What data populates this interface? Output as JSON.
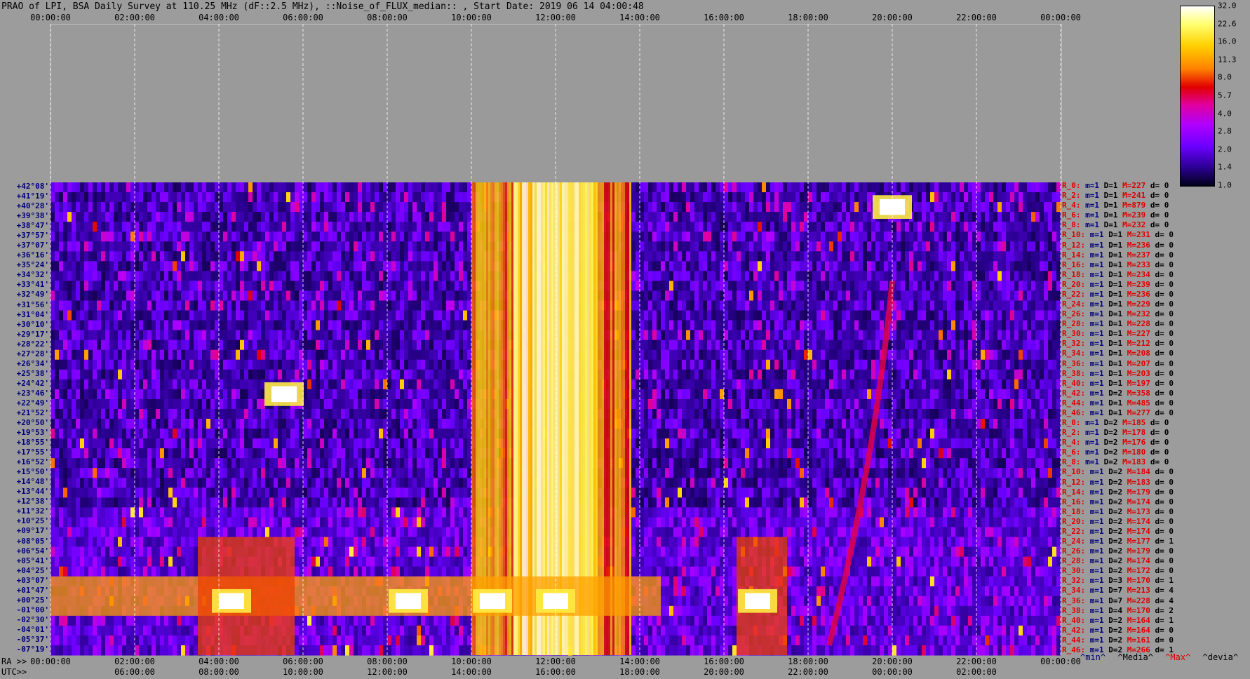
{
  "title": "PRAO of LPI, BSA Daily Survey at 110.25 MHz (dF::2.5 MHz), ::Noise_of_FLUX_median:: , Start Date: 2019 06 14 04:00:48",
  "colors": {
    "background": "#9c9c9c",
    "label_blue": "#00007a",
    "label_red": "#e00000"
  },
  "chart_data": {
    "type": "heatmap",
    "title": "PRAO of LPI, BSA Daily Survey at 110.25 MHz (dF::2.5 MHz), ::Noise_of_FLUX_median:: , Start Date: 2019 06 14 04:00:48",
    "colormap": "fire (black-blue-purple-red-orange-yellow-white)",
    "colorbar_ticks": [
      "32.0",
      "22.6",
      "16.0",
      "11.3",
      "8.0",
      "5.7",
      "4.0",
      "2.8",
      "2.0",
      "1.4",
      "1.0"
    ],
    "colorbar_range": [
      1.0,
      32.0
    ],
    "colorbar_scale": "log",
    "x_top_ticks": [
      "00:00:00",
      "02:00:00",
      "04:00:00",
      "06:00:00",
      "08:00:00",
      "10:00:00",
      "12:00:00",
      "14:00:00",
      "16:00:00",
      "18:00:00",
      "20:00:00",
      "22:00:00",
      "00:00:00"
    ],
    "ra_axis_label": "RA >>",
    "ra_ticks": [
      "00:00:00",
      "02:00:00",
      "04:00:00",
      "06:00:00",
      "08:00:00",
      "10:00:00",
      "12:00:00",
      "14:00:00",
      "16:00:00",
      "18:00:00",
      "20:00:00",
      "22:00:00",
      "00:00:00"
    ],
    "utc_axis_label": "UTC>>",
    "utc_ticks": [
      "06:00:00",
      "08:00:00",
      "10:00:00",
      "12:00:00",
      "14:00:00",
      "16:00:00",
      "18:00:00",
      "20:00:00",
      "22:00:00",
      "00:00:00",
      "02:00:00"
    ],
    "declinations": [
      "+42°08'",
      "+41°19'",
      "+40°28'",
      "+39°38'",
      "+38°47'",
      "+37°57'",
      "+37°07'",
      "+36°16'",
      "+35°24'",
      "+34°32'",
      "+33°41'",
      "+32°49'",
      "+31°56'",
      "+31°04'",
      "+30°10'",
      "+29°17'",
      "+28°22'",
      "+27°28'",
      "+26°34'",
      "+25°38'",
      "+24°42'",
      "+23°46'",
      "+22°49'",
      "+21°52'",
      "+20°50'",
      "+19°53'",
      "+18°55'",
      "+17°55'",
      "+16°52'",
      "+15°50'",
      "+14°48'",
      "+13°44'",
      "+12°38'",
      "+11°32'",
      "+10°25'",
      "+09°17'",
      "+08°05'",
      "+06°54'",
      "+05°41'",
      "+04°25'",
      "+03°07'",
      "+01°47'",
      "+00°25'",
      "-01°00'",
      "-02°30'",
      "-04°01'",
      "-05°37'",
      "-07°19'"
    ],
    "row_stats": [
      {
        "r": "R_0:",
        "m": "m=1",
        "D": "D=1",
        "M": "M=227",
        "d": "d= 0"
      },
      {
        "r": "R_2:",
        "m": "m=1",
        "D": "D=1",
        "M": "M=241",
        "d": "d= 0"
      },
      {
        "r": "R_4:",
        "m": "m=1",
        "D": "D=1",
        "M": "M=879",
        "d": "d= 0"
      },
      {
        "r": "R_6:",
        "m": "m=1",
        "D": "D=1",
        "M": "M=239",
        "d": "d= 0"
      },
      {
        "r": "R_8:",
        "m": "m=1",
        "D": "D=1",
        "M": "M=232",
        "d": "d= 0"
      },
      {
        "r": "R_10:",
        "m": "m=1",
        "D": "D=1",
        "M": "M=231",
        "d": "d= 0"
      },
      {
        "r": "R_12:",
        "m": "m=1",
        "D": "D=1",
        "M": "M=236",
        "d": "d= 0"
      },
      {
        "r": "R_14:",
        "m": "m=1",
        "D": "D=1",
        "M": "M=237",
        "d": "d= 0"
      },
      {
        "r": "R_16:",
        "m": "m=1",
        "D": "D=1",
        "M": "M=233",
        "d": "d= 0"
      },
      {
        "r": "R_18:",
        "m": "m=1",
        "D": "D=1",
        "M": "M=234",
        "d": "d= 0"
      },
      {
        "r": "R_20:",
        "m": "m=1",
        "D": "D=1",
        "M": "M=239",
        "d": "d= 0"
      },
      {
        "r": "R_22:",
        "m": "m=1",
        "D": "D=1",
        "M": "M=236",
        "d": "d= 0"
      },
      {
        "r": "R_24:",
        "m": "m=1",
        "D": "D=1",
        "M": "M=229",
        "d": "d= 0"
      },
      {
        "r": "R_26:",
        "m": "m=1",
        "D": "D=1",
        "M": "M=232",
        "d": "d= 0"
      },
      {
        "r": "R_28:",
        "m": "m=1",
        "D": "D=1",
        "M": "M=228",
        "d": "d= 0"
      },
      {
        "r": "R_30:",
        "m": "m=1",
        "D": "D=1",
        "M": "M=227",
        "d": "d= 0"
      },
      {
        "r": "R_32:",
        "m": "m=1",
        "D": "D=1",
        "M": "M=212",
        "d": "d= 0"
      },
      {
        "r": "R_34:",
        "m": "m=1",
        "D": "D=1",
        "M": "M=208",
        "d": "d= 0"
      },
      {
        "r": "R_36:",
        "m": "m=1",
        "D": "D=1",
        "M": "M=207",
        "d": "d= 0"
      },
      {
        "r": "R_38:",
        "m": "m=1",
        "D": "D=1",
        "M": "M=203",
        "d": "d= 0"
      },
      {
        "r": "R_40:",
        "m": "m=1",
        "D": "D=1",
        "M": "M=197",
        "d": "d= 0"
      },
      {
        "r": "R_42:",
        "m": "m=1",
        "D": "D=2",
        "M": "M=358",
        "d": "d= 0"
      },
      {
        "r": "R_44:",
        "m": "m=1",
        "D": "D=1",
        "M": "M=485",
        "d": "d= 0"
      },
      {
        "r": "R_46:",
        "m": "m=1",
        "D": "D=1",
        "M": "M=277",
        "d": "d= 0"
      },
      {
        "r": "R_0:",
        "m": "m=1",
        "D": "D=2",
        "M": "M=185",
        "d": "d= 0"
      },
      {
        "r": "R_2:",
        "m": "m=1",
        "D": "D=2",
        "M": "M=178",
        "d": "d= 0"
      },
      {
        "r": "R_4:",
        "m": "m=1",
        "D": "D=2",
        "M": "M=176",
        "d": "d= 0"
      },
      {
        "r": "R_6:",
        "m": "m=1",
        "D": "D=2",
        "M": "M=180",
        "d": "d= 0"
      },
      {
        "r": "R_8:",
        "m": "m=1",
        "D": "D=2",
        "M": "M=183",
        "d": "d= 0"
      },
      {
        "r": "R_10:",
        "m": "m=1",
        "D": "D=2",
        "M": "M=184",
        "d": "d= 0"
      },
      {
        "r": "R_12:",
        "m": "m=1",
        "D": "D=2",
        "M": "M=183",
        "d": "d= 0"
      },
      {
        "r": "R_14:",
        "m": "m=1",
        "D": "D=2",
        "M": "M=179",
        "d": "d= 0"
      },
      {
        "r": "R_16:",
        "m": "m=1",
        "D": "D=2",
        "M": "M=174",
        "d": "d= 0"
      },
      {
        "r": "R_18:",
        "m": "m=1",
        "D": "D=2",
        "M": "M=173",
        "d": "d= 0"
      },
      {
        "r": "R_20:",
        "m": "m=1",
        "D": "D=2",
        "M": "M=174",
        "d": "d= 0"
      },
      {
        "r": "R_22:",
        "m": "m=1",
        "D": "D=2",
        "M": "M=174",
        "d": "d= 0"
      },
      {
        "r": "R_24:",
        "m": "m=1",
        "D": "D=2",
        "M": "M=177",
        "d": "d= 1"
      },
      {
        "r": "R_26:",
        "m": "m=1",
        "D": "D=2",
        "M": "M=179",
        "d": "d= 0"
      },
      {
        "r": "R_28:",
        "m": "m=1",
        "D": "D=2",
        "M": "M=174",
        "d": "d= 0"
      },
      {
        "r": "R_30:",
        "m": "m=1",
        "D": "D=2",
        "M": "M=172",
        "d": "d= 0"
      },
      {
        "r": "R_32:",
        "m": "m=1",
        "D": "D=3",
        "M": "M=170",
        "d": "d= 1"
      },
      {
        "r": "R_34:",
        "m": "m=1",
        "D": "D=7",
        "M": "M=213",
        "d": "d= 4"
      },
      {
        "r": "R_36:",
        "m": "m=1",
        "D": "D=7",
        "M": "M=228",
        "d": "d= 4"
      },
      {
        "r": "R_38:",
        "m": "m=1",
        "D": "D=4",
        "M": "M=170",
        "d": "d= 2"
      },
      {
        "r": "R_40:",
        "m": "m=1",
        "D": "D=2",
        "M": "M=164",
        "d": "d= 1"
      },
      {
        "r": "R_42:",
        "m": "m=1",
        "D": "D=2",
        "M": "M=164",
        "d": "d= 0"
      },
      {
        "r": "R_44:",
        "m": "m=1",
        "D": "D=2",
        "M": "M=161",
        "d": "d= 0"
      },
      {
        "r": "R_46:",
        "m": "m=1",
        "D": "D=2",
        "M": "M=266",
        "d": "d= 1"
      }
    ],
    "legend": {
      "min": "^min^",
      "median": "^Media^",
      "max": "^Max^",
      "deviation": "^devia^"
    },
    "features": [
      {
        "type": "vertical_band",
        "ra_start_h": 10.0,
        "ra_end_h": 13.8,
        "intensity": 11.3
      },
      {
        "type": "vertical_band_core",
        "ra_start_h": 11.0,
        "ra_end_h": 13.0,
        "intensity": 22.6
      },
      {
        "type": "horizontal_band",
        "rows": [
          40,
          43
        ],
        "ra_start_h": 0.0,
        "ra_end_h": 14.5,
        "intensity": 11.3
      },
      {
        "type": "horizontal_band",
        "rows": [
          36,
          47
        ],
        "ra_start_h": 3.5,
        "ra_end_h": 5.8,
        "intensity": 8.0
      },
      {
        "type": "horizontal_band",
        "rows": [
          36,
          47
        ],
        "ra_start_h": 16.3,
        "ra_end_h": 17.5,
        "intensity": 8.0
      },
      {
        "type": "source",
        "ra_h": 5.55,
        "row": 21,
        "intensity": 32.0
      },
      {
        "type": "source",
        "ra_h": 20.0,
        "row": 2,
        "intensity": 32.0
      },
      {
        "type": "source",
        "ra_h": 4.3,
        "row": 42,
        "intensity": 32.0
      },
      {
        "type": "source",
        "ra_h": 8.5,
        "row": 42,
        "intensity": 32.0
      },
      {
        "type": "source",
        "ra_h": 10.5,
        "row": 42,
        "intensity": 32.0
      },
      {
        "type": "source",
        "ra_h": 16.8,
        "row": 42,
        "intensity": 32.0
      },
      {
        "type": "source",
        "ra_h": 12.0,
        "row": 42,
        "intensity": 32.0
      },
      {
        "type": "diagonal_arc",
        "ra_start_h": 18.5,
        "row_start": 47,
        "ra_end_h": 20.0,
        "row_end": 10,
        "intensity": 5.7
      }
    ]
  }
}
